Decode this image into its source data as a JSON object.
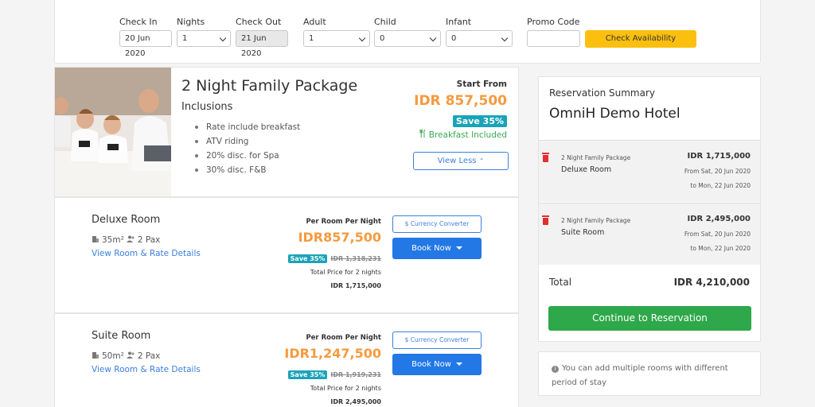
{
  "search": {
    "check_in_label": "Check In",
    "check_in_value": "20 Jun 2020",
    "nights_label": "Nights",
    "nights_value": "1",
    "check_out_label": "Check Out",
    "check_out_value": "21 Jun 2020",
    "adult_label": "Adult",
    "adult_value": "1",
    "child_label": "Child",
    "child_value": "0",
    "infant_label": "Infant",
    "infant_value": "0",
    "promo_label": "Promo Code",
    "promo_value": "",
    "check_button": "Check Availability"
  },
  "package": {
    "title": "2 Night Family Package",
    "inclusions_label": "Inclusions",
    "inclusions": [
      "Rate include breakfast",
      "ATV riding",
      "20% disc. for Spa",
      "30% disc. F&B"
    ],
    "start_from": "Start From",
    "price": "IDR 857,500",
    "save": "Save 35%",
    "breakfast": "Breakfast Included",
    "view_less": "View Less"
  },
  "rooms": [
    {
      "name": "Deluxe Room",
      "size": "35m²",
      "pax": "2 Pax",
      "link": "View Room & Rate Details",
      "per_room_label": "Per Room Per Night",
      "price": "IDR857,500",
      "save": "Save 35%",
      "original": "IDR 1,318,231",
      "total_label": "Total Price for 2 nights",
      "total": "IDR 1,715,000",
      "currency_button": "Currency Converter",
      "book_button": "Book Now"
    },
    {
      "name": "Suite Room",
      "size": "50m²",
      "pax": "2 Pax",
      "link": "View Room & Rate Details",
      "per_room_label": "Per Room Per Night",
      "price": "IDR1,247,500",
      "save": "Save 35%",
      "original": "IDR 1,919,231",
      "total_label": "Total Price for 2 nights",
      "total": "IDR 2,495,000",
      "currency_button": "Currency Converter",
      "book_button": "Book Now"
    }
  ],
  "summary": {
    "heading": "Reservation Summary",
    "hotel": "OmniH Demo Hotel",
    "items": [
      {
        "package": "2 Night Family Package",
        "room": "Deluxe Room",
        "amount": "IDR 1,715,000",
        "from": "From Sat, 20 Jun 2020",
        "to": "to Mon, 22 Jun 2020"
      },
      {
        "package": "2 Night Family Package",
        "room": "Suite Room",
        "amount": "IDR 2,495,000",
        "from": "From Sat, 20 Jun 2020",
        "to": "to Mon, 22 Jun 2020"
      }
    ],
    "total_label": "Total",
    "total_value": "IDR 4,210,000",
    "continue_button": "Continue to Reservation",
    "note": "You can add multiple rooms with different period of stay"
  },
  "colors": {
    "accent_orange": "#f59a3e",
    "primary_blue": "#2378e6",
    "save_teal": "#1aa3b8",
    "success_green": "#2ea84a",
    "check_yellow": "#fbbf0f"
  }
}
